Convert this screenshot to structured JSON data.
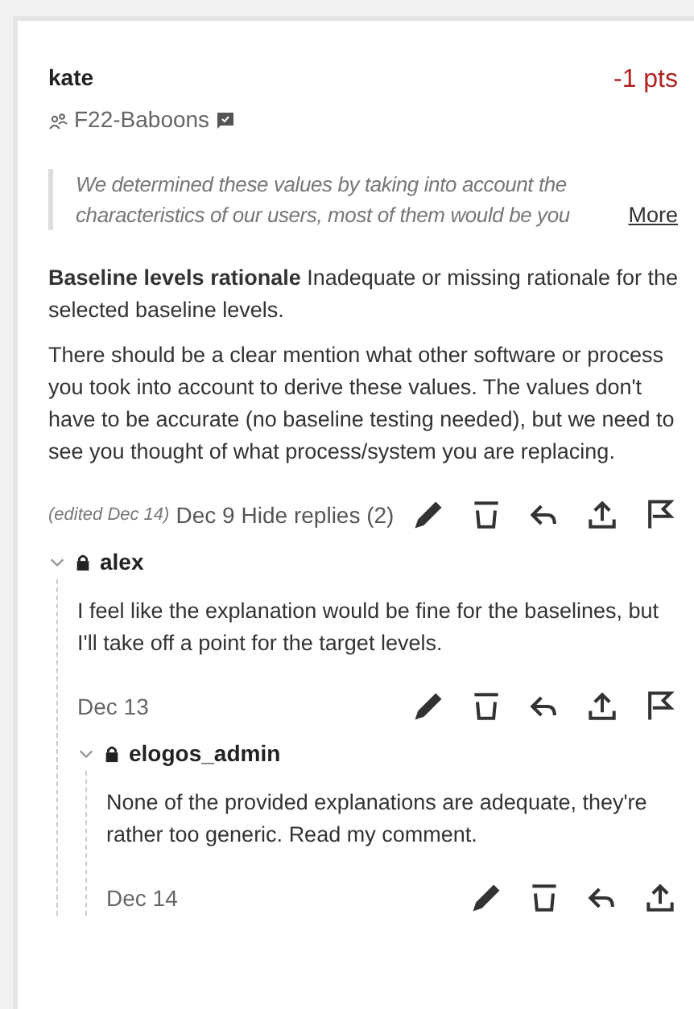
{
  "comment": {
    "author": "kate",
    "points": "-1 pts",
    "group": "F22-Baboons",
    "quote": {
      "text": "We determined these values by taking into account the characteristics of our users, most of them would be you",
      "more_link": "More"
    },
    "criterion": {
      "title": "Baseline levels rationale",
      "description": "Inadequate or missing rationale for the selected baseline levels."
    },
    "body": "There should be a clear mention what other software or process you took into account to derive these values. The values don't have to be accurate (no baseline testing needed), but we need to see you thought of what process/system you are replacing.",
    "edited": "(edited Dec 14)",
    "date": "Dec 9",
    "replies_toggle": "Hide replies (2)",
    "actions": [
      {
        "kind": "edit"
      },
      {
        "kind": "delete"
      },
      {
        "kind": "reply"
      },
      {
        "kind": "share"
      },
      {
        "kind": "flag"
      }
    ],
    "replies": [
      {
        "author": "alex",
        "expanded": true,
        "private": true,
        "text": "I feel like the explanation would be fine for the baselines, but I'll take off a point for the target levels.",
        "date": "Dec 13",
        "actions": [
          {
            "kind": "edit"
          },
          {
            "kind": "delete"
          },
          {
            "kind": "reply"
          },
          {
            "kind": "share"
          },
          {
            "kind": "flag"
          }
        ],
        "children": [
          {
            "author": "elogos_admin",
            "expanded": true,
            "private": true,
            "text": "None of the provided explanations are adequate, they're rather too generic. Read my comment.",
            "date": "Dec 14",
            "actions": [
              {
                "kind": "edit"
              },
              {
                "kind": "delete"
              },
              {
                "kind": "reply"
              },
              {
                "kind": "share"
              }
            ]
          }
        ]
      }
    ]
  }
}
